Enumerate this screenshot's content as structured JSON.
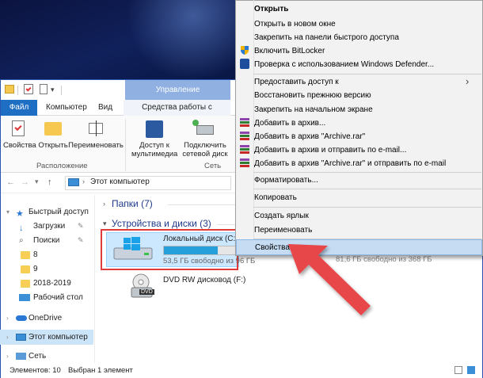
{
  "ribbon": {
    "manage_tab": "Управление",
    "tabs": [
      "Файл",
      "Компьютер",
      "Вид",
      "Средства работы с дисками"
    ],
    "buttons": {
      "properties": "Свойства",
      "open": "Открыть",
      "rename": "Переименовать",
      "media_access_1": "Доступ к",
      "media_access_2": "мультимедиа",
      "map_drive_1": "Подключить",
      "map_drive_2": "сетевой диск"
    },
    "groups": {
      "location": "Расположение",
      "network": "Сеть"
    }
  },
  "address": {
    "path": "Этот компьютер"
  },
  "nav": {
    "quick_access": "Быстрый доступ",
    "downloads": "Загрузки",
    "search": "Поиски",
    "folder_8": "8",
    "folder_9": "9",
    "folder_2018": "2018-2019",
    "desktop": "Рабочий стол",
    "onedrive": "OneDrive",
    "this_pc": "Этот компьютер",
    "network": "Сеть"
  },
  "content": {
    "folders_header": "Папки (7)",
    "devices_header": "Устройства и диски (3)",
    "drive_c": {
      "name": "Локальный диск (C:)",
      "free": "53,5 ГБ свободно из 9",
      "free_tail": "6 ГБ",
      "used_fraction": 0.72
    },
    "drive_d_free": "81,6 ГБ свободно из 368 ГБ",
    "dvd": {
      "name": "DVD RW дисковод (F:)",
      "badge": "DVD"
    }
  },
  "status": {
    "count": "Элементов: 10",
    "selected": "Выбран 1 элемент"
  },
  "context_menu": {
    "items": [
      "Открыть",
      "Открыть в новом окне",
      "Закрепить на панели быстрого доступа",
      "Включить BitLocker",
      "Проверка с использованием Windows Defender...",
      "Предоставить доступ к",
      "Восстановить прежнюю версию",
      "Закрепить на начальном экране",
      "Добавить в архив...",
      "Добавить в архив \"Archive.rar\"",
      "Добавить в архив и отправить по e-mail...",
      "Добавить в архив \"Archive.rar\" и отправить по e-mail",
      "Форматировать...",
      "Копировать",
      "Создать ярлык",
      "Переименовать",
      "Свойства"
    ],
    "submenu_arrow": "›"
  },
  "colors": {
    "accent": "#1e6fc4",
    "manage_tab": "#8fb0e0",
    "selection": "#cce4f7",
    "highlight_box": "#e03c3c",
    "arrow": "#e8474a",
    "progress": "#26a0da"
  }
}
